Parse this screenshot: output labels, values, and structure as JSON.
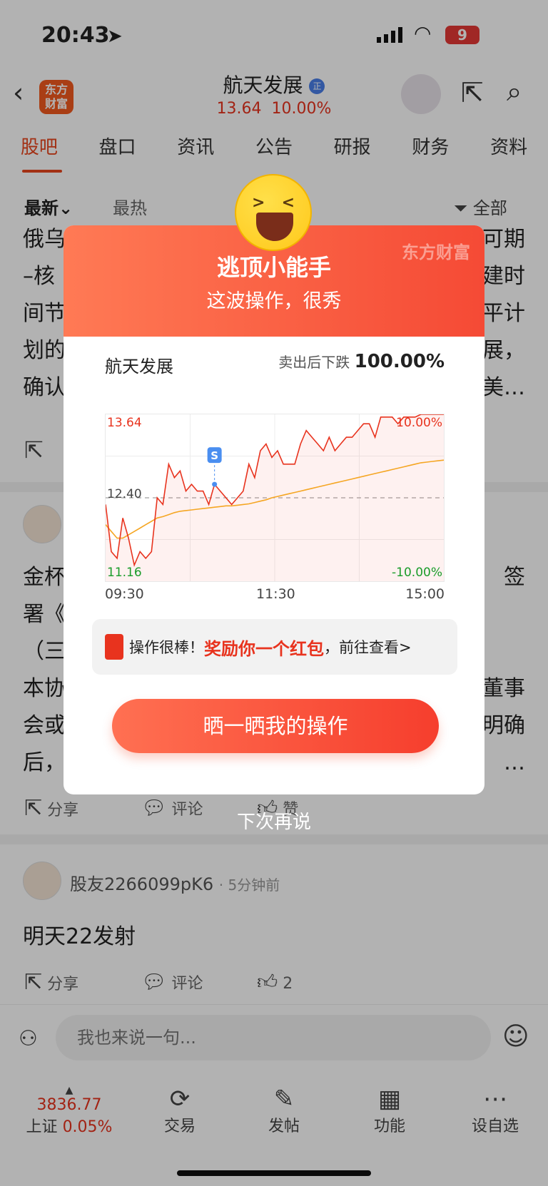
{
  "status_bar": {
    "time": "20:43",
    "battery": "9"
  },
  "header": {
    "logo_line1": "东方",
    "logo_line2": "财富",
    "stock_name": "航天发展",
    "price": "13.64",
    "change": "10.00%"
  },
  "tabs": [
    {
      "label": "股吧"
    },
    {
      "label": "盘口"
    },
    {
      "label": "资讯"
    },
    {
      "label": "公告"
    },
    {
      "label": "研报"
    },
    {
      "label": "财务"
    },
    {
      "label": "资料"
    }
  ],
  "filter": {
    "latest": "最新",
    "hot": "最热",
    "all": "全部"
  },
  "posts": {
    "p1_lines": [
      "俄乌",
      "–核",
      "间节",
      "划的",
      "确认"
    ],
    "p1_right": [
      "可期",
      "建时",
      "平计",
      "展，",
      "美…"
    ],
    "p2_lines": [
      "金杯",
      "署《",
      "（三",
      "本协",
      "会或",
      "后，"
    ],
    "p2_right": [
      "签",
      "",
      "",
      "董事",
      "明确",
      "…"
    ],
    "p3_user": "股友2266099pK6",
    "p3_time": "· 5分钟前",
    "p3_text": "明天22发射",
    "share": "分享",
    "comment": "评论",
    "like_count": "2",
    "like_partial": "赞"
  },
  "input": {
    "placeholder": "我也来说一句..."
  },
  "bottom_nav": {
    "index_value": "3836.77",
    "index_name": "上证",
    "index_change": "0.05%",
    "items": [
      {
        "label": "交易"
      },
      {
        "label": "发帖"
      },
      {
        "label": "功能"
      },
      {
        "label": "设自选"
      }
    ]
  },
  "modal": {
    "watermark": "东方财富",
    "title": "逃顶小能手",
    "subtitle": "这波操作，很秀",
    "stock": "航天发展",
    "after_sell_label": "卖出后下跌",
    "after_sell_value": "100.00%",
    "reward_prefix": "操作很棒！",
    "reward_highlight": "奖励你一个红包",
    "reward_suffix": "，前往查看>",
    "share_button": "晒一晒我的操作",
    "dismiss": "下次再说",
    "sell_marker": "S"
  },
  "chart_data": {
    "type": "line",
    "y_top_label": "13.64",
    "y_mid_label": "12.40",
    "y_bottom_label": "11.16",
    "pct_top": "10.00%",
    "pct_bottom": "-10.00%",
    "x_labels": [
      "09:30",
      "11:30",
      "15:00"
    ],
    "ylim": [
      11.16,
      13.64
    ],
    "prev_close": 12.4,
    "price": [
      12.3,
      11.6,
      11.5,
      12.1,
      11.8,
      11.4,
      11.6,
      11.5,
      11.6,
      12.4,
      12.3,
      12.9,
      12.7,
      12.8,
      12.5,
      12.6,
      12.5,
      12.5,
      12.3,
      12.6,
      12.5,
      12.4,
      12.3,
      12.4,
      12.5,
      12.9,
      12.7,
      13.1,
      13.2,
      13.0,
      13.1,
      12.9,
      12.9,
      12.9,
      13.2,
      13.4,
      13.3,
      13.2,
      13.1,
      13.3,
      13.1,
      13.2,
      13.3,
      13.3,
      13.4,
      13.5,
      13.5,
      13.3,
      13.6,
      13.6,
      13.6,
      13.5,
      13.6,
      13.6,
      13.6,
      13.64,
      13.64,
      13.64,
      13.64,
      13.64
    ],
    "avg": [
      12.0,
      11.9,
      11.8,
      11.8,
      11.85,
      11.9,
      11.95,
      12.0,
      12.05,
      12.1,
      12.12,
      12.15,
      12.18,
      12.2,
      12.21,
      12.22,
      12.23,
      12.24,
      12.25,
      12.26,
      12.27,
      12.28,
      12.28,
      12.29,
      12.3,
      12.31,
      12.33,
      12.35,
      12.37,
      12.4,
      12.42,
      12.44,
      12.46,
      12.48,
      12.5,
      12.52,
      12.54,
      12.56,
      12.58,
      12.6,
      12.62,
      12.64,
      12.66,
      12.68,
      12.7,
      12.72,
      12.74,
      12.76,
      12.78,
      12.8,
      12.82,
      12.84,
      12.86,
      12.88,
      12.9,
      12.92,
      12.93,
      12.94,
      12.95,
      12.96
    ],
    "sell_index": 19
  }
}
